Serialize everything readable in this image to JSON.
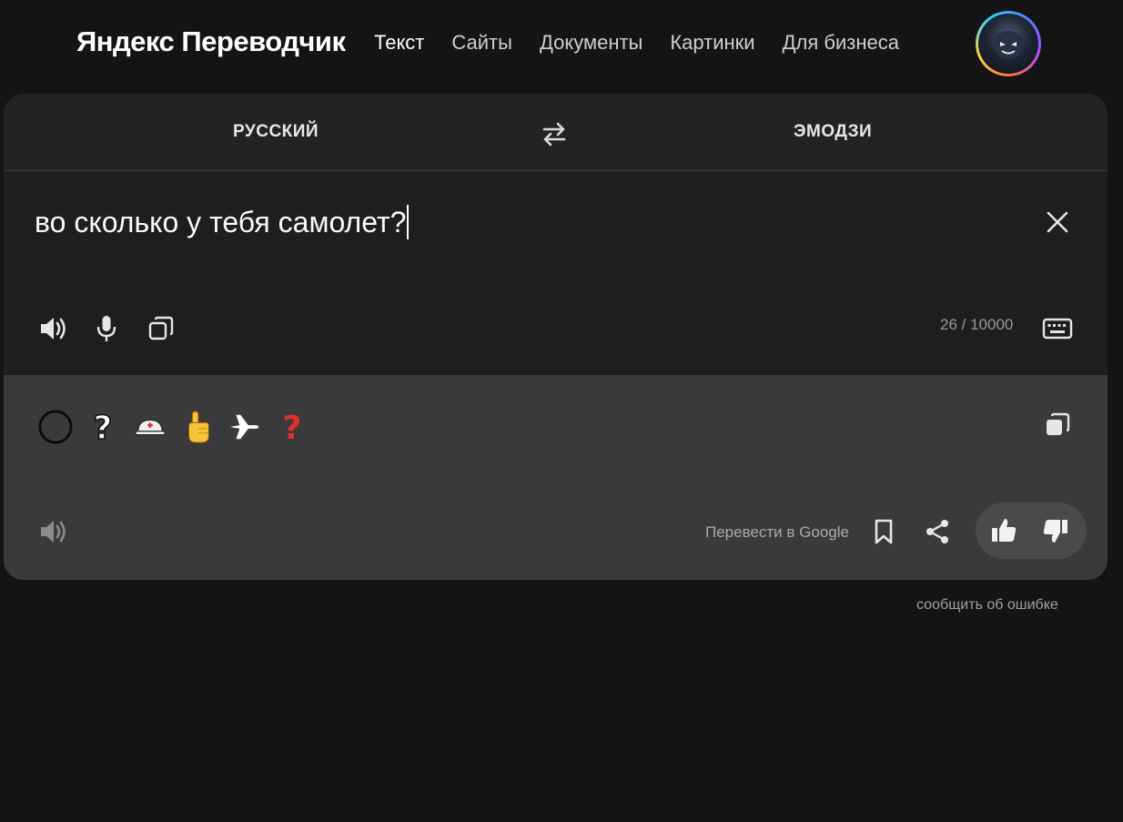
{
  "header": {
    "logo": "Яндекс Переводчик",
    "nav": [
      {
        "label": "Текст",
        "active": true
      },
      {
        "label": "Сайты",
        "active": false
      },
      {
        "label": "Документы",
        "active": false
      },
      {
        "label": "Картинки",
        "active": false
      },
      {
        "label": "Для бизнеса",
        "active": false
      }
    ]
  },
  "languages": {
    "source": "РУССКИЙ",
    "target": "ЭМОДЗИ",
    "swap_icon": "swap-arrows-icon"
  },
  "source": {
    "text": "во сколько у тебя самолет?",
    "counter": "26 / 10000",
    "icons": [
      "speaker-icon",
      "microphone-icon",
      "copy-icon",
      "keyboard-icon",
      "close-icon"
    ]
  },
  "output": {
    "emojis": [
      "⭕",
      "❔",
      "⛑",
      "👆",
      "✈",
      "❓"
    ],
    "google_link": "Перевести в Google",
    "icons": [
      "speaker-icon",
      "copy-icon",
      "bookmark-icon",
      "share-icon",
      "thumbs-up-icon",
      "thumbs-down-icon"
    ]
  },
  "footer": {
    "report": "сообщить об ошибке"
  },
  "colors": {
    "page_bg": "#141415",
    "panel_bg": "#232325",
    "input_bg": "#1e1e20",
    "output_bg": "#3a3a3c"
  }
}
